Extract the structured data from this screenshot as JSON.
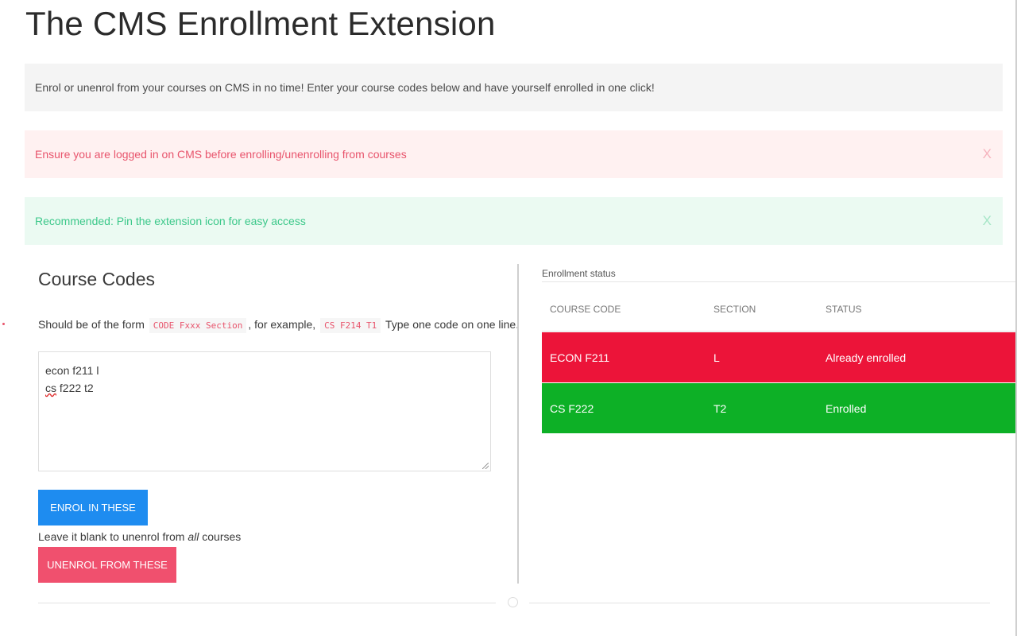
{
  "header": {
    "title": "The CMS Enrollment Extension"
  },
  "panels": {
    "info": "Enrol or unenrol from your courses on CMS in no time! Enter your course codes below and have yourself enrolled in one click!",
    "login_warning": "Ensure you are logged in on CMS before enrolling/unenrolling from courses",
    "pin_tip": "Recommended: Pin the extension icon for easy access",
    "close_label": "X"
  },
  "form": {
    "title": "Course Codes",
    "hint_prefix": "Should be of the form",
    "format_code": "CODE Fxxx Section",
    "hint_middle": ", for example,",
    "example_code": "CS F214 T1",
    "hint_suffix": "Type one code on one line.",
    "codes_line1": "econ f211 l",
    "codes_line2_word": "cs",
    "codes_line2_rest": " f222 t2",
    "enrol_label": "ENROL IN THESE",
    "unenrol_hint_prefix": "Leave it blank to unenrol from ",
    "unenrol_hint_emphasis": "all",
    "unenrol_hint_suffix": " courses",
    "unenrol_label": "UNENROL FROM THESE"
  },
  "status": {
    "caption": "Enrollment status",
    "columns": [
      "COURSE CODE",
      "SECTION",
      "STATUS"
    ],
    "rows": [
      {
        "code": "ECON F211",
        "section": "L",
        "status": "Already enrolled",
        "color": "#ec1439"
      },
      {
        "code": "CS F222",
        "section": "T2",
        "status": "Enrolled",
        "color": "#0db026"
      }
    ]
  },
  "colors": {
    "primary": "#1e8cf0",
    "danger": "#f0506e",
    "success_text": "#3cc88a"
  }
}
